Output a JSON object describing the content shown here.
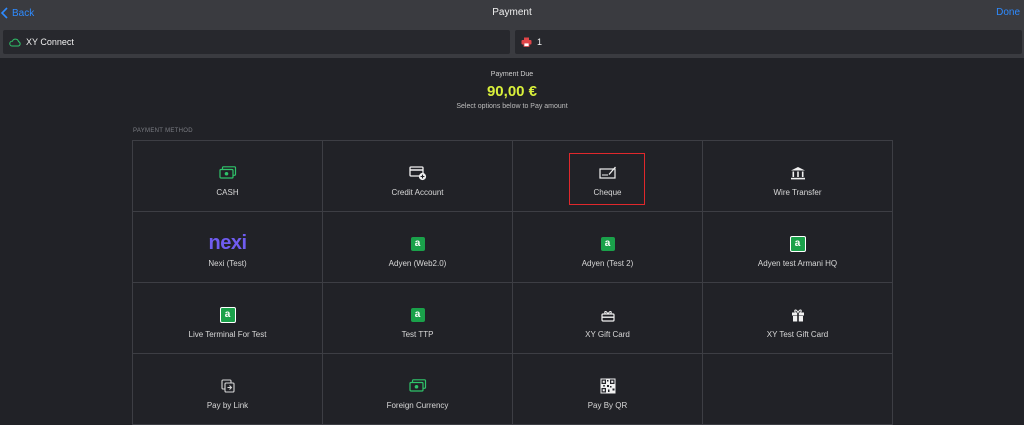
{
  "header": {
    "back_label": "Back",
    "title": "Payment",
    "done_label": "Done"
  },
  "status": {
    "connection_label": "XY Connect",
    "printer_count": "1"
  },
  "payment": {
    "due_label": "Payment Due",
    "amount": "90,00 €",
    "hint": "Select options below to Pay amount",
    "section_label": "PAYMENT METHOD"
  },
  "methods": [
    {
      "label": "CASH",
      "icon": "cash-icon"
    },
    {
      "label": "Credit Account",
      "icon": "credit-account-icon"
    },
    {
      "label": "Cheque",
      "icon": "cheque-icon",
      "selected": true
    },
    {
      "label": "Wire Transfer",
      "icon": "bank-icon"
    },
    {
      "label": "Nexi (Test)",
      "icon": "nexi-logo",
      "logo_text": "nexi"
    },
    {
      "label": "Adyen (Web2.0)",
      "icon": "adyen-icon",
      "logo_text": "a"
    },
    {
      "label": "Adyen (Test 2)",
      "icon": "adyen-icon",
      "logo_text": "a"
    },
    {
      "label": "Adyen test Armani HQ",
      "icon": "adyen-icon",
      "logo_text": "a"
    },
    {
      "label": "Live Terminal For Test",
      "icon": "adyen-icon",
      "logo_text": "a"
    },
    {
      "label": "Test TTP",
      "icon": "adyen-icon",
      "logo_text": "a"
    },
    {
      "label": "XY Gift Card",
      "icon": "gift-card-icon"
    },
    {
      "label": "XY Test Gift Card",
      "icon": "gift-icon"
    },
    {
      "label": "Pay by Link",
      "icon": "pay-by-link-icon"
    },
    {
      "label": "Foreign Currency",
      "icon": "cash-icon"
    },
    {
      "label": "Pay By QR",
      "icon": "qr-code-icon"
    },
    {
      "label": "",
      "icon": ""
    }
  ],
  "colors": {
    "accent_blue": "#2e8bff",
    "amount_green": "#d9f03b",
    "cash_green": "#2fc36a",
    "adyen_green": "#1aa14a",
    "nexi_purple": "#6f5cf0",
    "selection_red": "#e0282c",
    "cloud_green": "#2fc36a",
    "printer_red": "#e04548"
  }
}
